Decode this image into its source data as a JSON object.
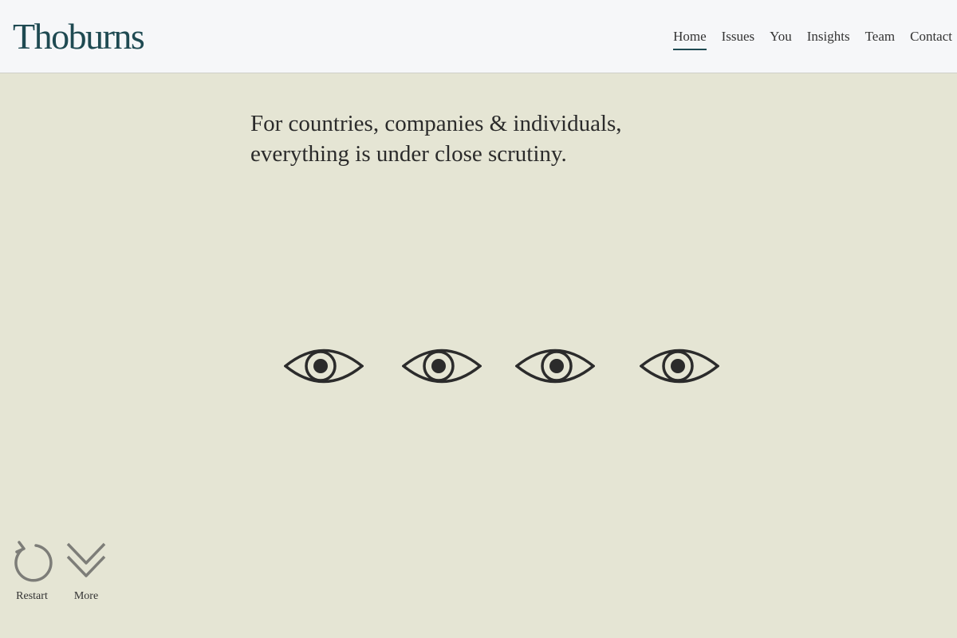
{
  "header": {
    "logo": "Thoburns",
    "nav": [
      {
        "label": "Home",
        "active": true
      },
      {
        "label": "Issues",
        "active": false
      },
      {
        "label": "You",
        "active": false
      },
      {
        "label": "Insights",
        "active": false
      },
      {
        "label": "Team",
        "active": false
      },
      {
        "label": "Contact",
        "active": false
      }
    ]
  },
  "main": {
    "headline_line1": "For countries, companies & individuals,",
    "headline_line2": "everything is under close scrutiny.",
    "icons": [
      "eye-icon",
      "eye-icon",
      "eye-icon",
      "eye-icon"
    ]
  },
  "controls": {
    "restart_label": "Restart",
    "more_label": "More"
  },
  "colors": {
    "background": "#e5e5d4",
    "header_bg": "#f6f7f9",
    "brand": "#1f4a52",
    "control_gray": "#7d7d78"
  }
}
